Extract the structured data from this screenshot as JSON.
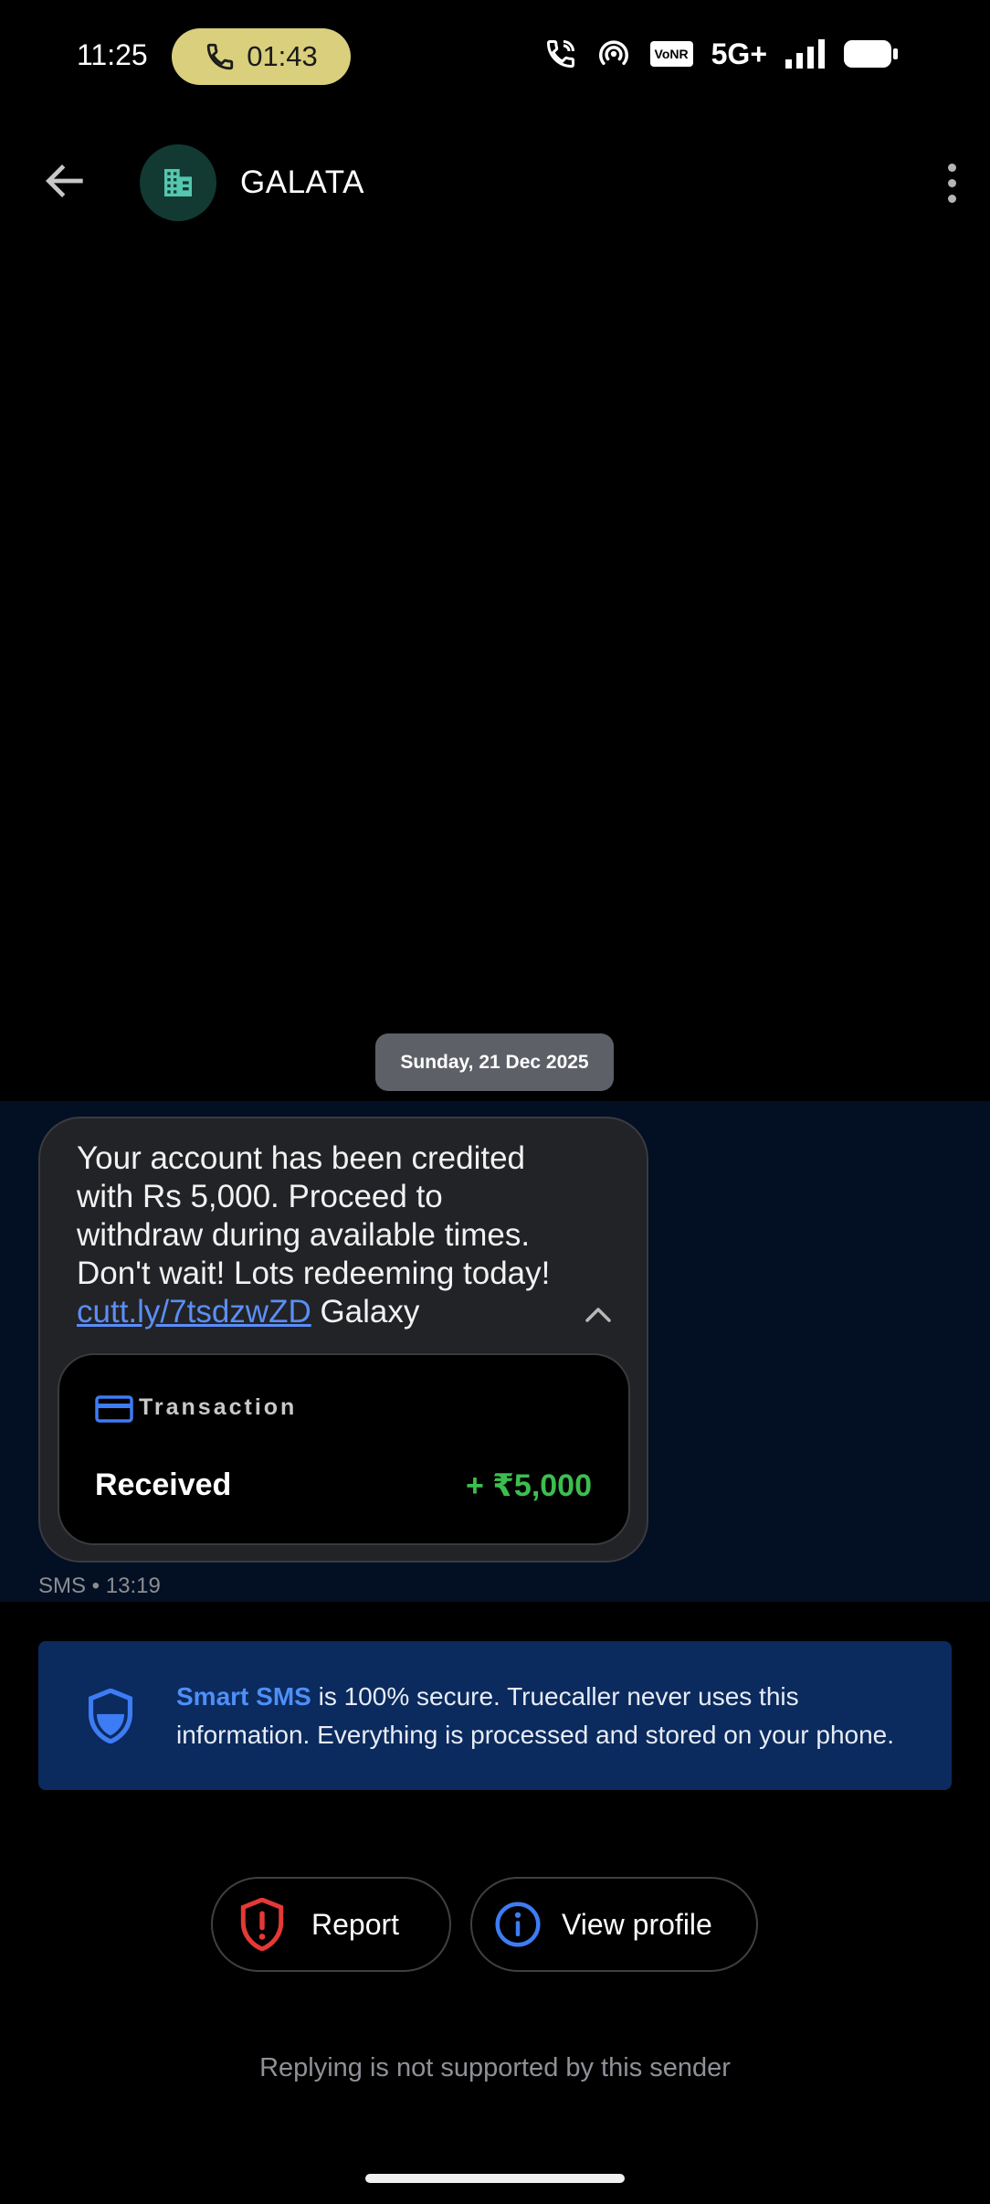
{
  "status_bar": {
    "time": "11:25",
    "call_timer": "01:43",
    "vonr": "VoNR",
    "network": "5G+",
    "icons": [
      "wifi-calling-icon",
      "hotspot-icon",
      "vonr-icon",
      "network-5g-icon",
      "signal-icon",
      "battery-icon"
    ]
  },
  "header": {
    "title": "GALATA",
    "avatar_icon": "building-icon",
    "back_icon": "arrow-left-icon",
    "menu_icon": "more-vertical-icon"
  },
  "conversation": {
    "date": "Sunday, 21 Dec 2025",
    "message": {
      "lines": [
        "Your account has been credited",
        "with Rs 5,000. Proceed to",
        "withdraw during available times.",
        "Don't wait! Lots redeeming today!"
      ],
      "link": "cutt.ly/7tsdzwZD",
      "link_suffix": " Galaxy",
      "meta": "SMS • 13:19"
    },
    "transaction": {
      "label": "Transaction",
      "status": "Received",
      "amount": "+ ₹5,000"
    }
  },
  "info_banner": {
    "strong": "Smart SMS",
    "text": " is 100% secure. Truecaller never uses this information. Everything is processed and stored on your phone."
  },
  "actions": {
    "report_label": "Report",
    "view_profile_label": "View profile"
  },
  "footer_note": "Replying is not supported by this sender",
  "colors": {
    "background": "#000000",
    "call_pill": "#d9cf7c",
    "link": "#5b8ef7",
    "amount_green": "#3cbe4e",
    "banner_bg": "#0b2a5e",
    "report_red": "#e53935",
    "profile_blue": "#3d7cf4"
  }
}
